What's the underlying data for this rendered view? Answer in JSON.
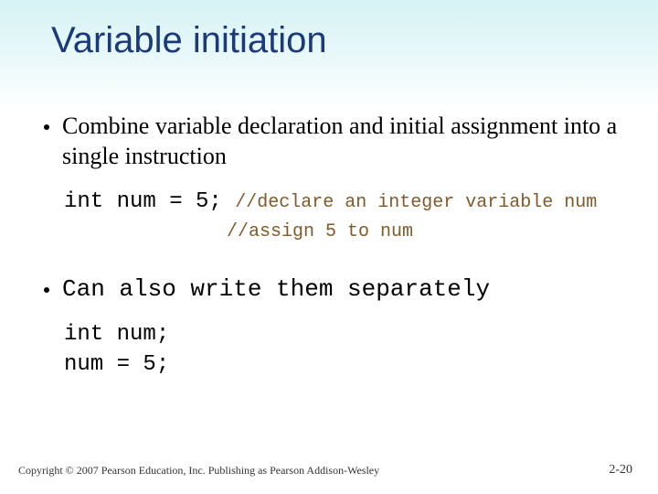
{
  "title": "Variable initiation",
  "bullets": {
    "b1": "Combine variable declaration and initial assignment into a single instruction",
    "b2": "Can also write them separately"
  },
  "code1": {
    "stmt": "int num = 5;",
    "comment1": "//declare an integer variable num",
    "comment2": "//assign 5 to num"
  },
  "code2": {
    "line1": "int num;",
    "line2": "num = 5;"
  },
  "footer": {
    "copyright": "Copyright © 2007 Pearson Education, Inc. Publishing as Pearson Addison-Wesley",
    "pagenum": "2-20"
  }
}
